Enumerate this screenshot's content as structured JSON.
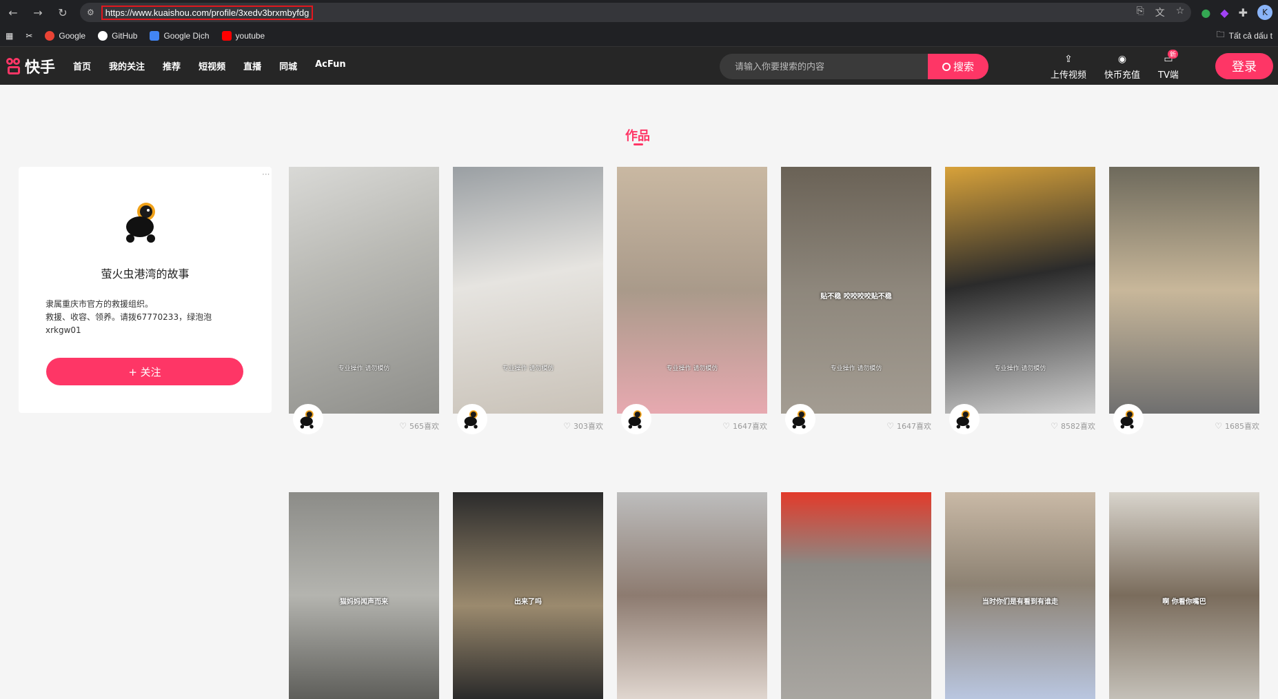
{
  "browser": {
    "url": "https://www.kuaishou.com/profile/3xedv3brxmbyfdg",
    "profile_initial": "K",
    "bookmarks": [
      {
        "label": "Google",
        "color": "#ea4335"
      },
      {
        "label": "GitHub",
        "color": "#ffffff"
      },
      {
        "label": "Google Dịch",
        "color": "#4285f4"
      },
      {
        "label": "youtube",
        "color": "#ff0000"
      }
    ],
    "all_bookmarks": "Tất cả dấu t"
  },
  "header": {
    "logo_text": "快手",
    "nav": [
      "首页",
      "我的关注",
      "推荐",
      "短视频",
      "直播",
      "同城",
      "AcFun"
    ],
    "search_placeholder": "请输入你要搜索的内容",
    "search_button": "搜索",
    "tools": [
      {
        "label": "上传视频",
        "icon": "upload-icon"
      },
      {
        "label": "快币充值",
        "icon": "coin-icon"
      },
      {
        "label": "TV端",
        "icon": "tv-icon",
        "badge": "新"
      }
    ],
    "login": "登录",
    "accent": "#fe3666"
  },
  "section": {
    "title": "作品"
  },
  "profile": {
    "name": "萤火虫港湾的故事",
    "desc_lines": [
      "隶属重庆市官方的救援组织。",
      "救援、收容、领养。请拨67770233，绿泡泡",
      "xrkgw01"
    ],
    "follow_label": "+ 关注",
    "more": "···"
  },
  "videos_row1": [
    {
      "likes": "565喜欢",
      "bg": "linear-gradient(160deg,#d9d9d6,#b9b9b4 40%,#8e8e8a)",
      "caption": "专业操作 请勿模仿"
    },
    {
      "likes": "303喜欢",
      "bg": "linear-gradient(170deg,#9a9fa3,#e6e4e0 45%,#c9c2b8)",
      "caption": "专业操作 请勿模仿"
    },
    {
      "likes": "1647喜欢",
      "bg": "linear-gradient(180deg,#c9b8a2,#a99a8a 50%,#e7a9b0)",
      "caption": "专业操作 请勿模仿"
    },
    {
      "likes": "1647喜欢",
      "bg": "linear-gradient(180deg,#6a6256,#8e877c 50%,#a39c92)",
      "caption": "专业操作 请勿模仿",
      "overlay": "贴不稳 咬咬咬咬贴不稳"
    },
    {
      "likes": "8582喜欢",
      "bg": "linear-gradient(170deg,#d8a23a,#2b2b2b 45%,#cfcfcf)",
      "caption": "专业操作 请勿模仿"
    },
    {
      "likes": "1685喜欢",
      "bg": "linear-gradient(180deg,#6e6a5c,#c8b79a 50%,#6f6f6f)",
      "caption": ""
    }
  ],
  "videos_row2": [
    {
      "bg": "linear-gradient(180deg,#8c8c88,#b4b4af 50%,#5e5e5a)",
      "overlay": "猫妈妈闻声而来"
    },
    {
      "bg": "linear-gradient(180deg,#2b2b2b,#9b8a6e 55%,#2a2a2a)",
      "overlay": "出来了吗"
    },
    {
      "bg": "linear-gradient(180deg,#bdbdbd,#8d7b70 50%,#e0d6cf)",
      "overlay": ""
    },
    {
      "bg": "linear-gradient(180deg,#e23a2a,#8b8984 35%,#a9a6a1)",
      "overlay": ""
    },
    {
      "bg": "linear-gradient(180deg,#c9b9a6,#8d8273 45%,#b9c6e0)",
      "overlay": "当时你们是有看到有谁走"
    },
    {
      "bg": "linear-gradient(180deg,#d8d4cc,#7a6c5c 50%,#c4c0b8)",
      "overlay": "啊 你看你嘴巴"
    }
  ]
}
